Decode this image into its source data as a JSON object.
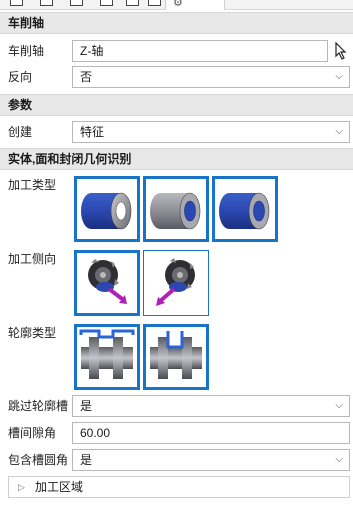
{
  "sections": {
    "turning_axis": "车削轴",
    "parameters": "参数",
    "recognition": "实体,面和封闭几何识别"
  },
  "fields": {
    "turning_axis": {
      "label": "车削轴",
      "value": "Z-轴"
    },
    "reverse": {
      "label": "反向",
      "value": "否"
    },
    "create": {
      "label": "创建",
      "value": "特征"
    },
    "skip_groove": {
      "label": "跳过轮廓槽",
      "value": "是"
    },
    "groove_gap_angle": {
      "label": "槽间隙角",
      "value": "60.00"
    },
    "include_groove_fillet": {
      "label": "包含槽圆角",
      "value": "是"
    }
  },
  "groups": {
    "machining_type": "加工类型",
    "machining_side": "加工侧向",
    "profile_type": "轮廓类型"
  },
  "collapsible": {
    "label": "加工区域"
  },
  "colors": {
    "accent": "#1874c9",
    "section_bg": "#e8e8e8",
    "arrow": "#b01fb6"
  },
  "icons": [
    "pick-cursor-icon",
    "chevron-down-icon",
    "expand-triangle-icon"
  ]
}
